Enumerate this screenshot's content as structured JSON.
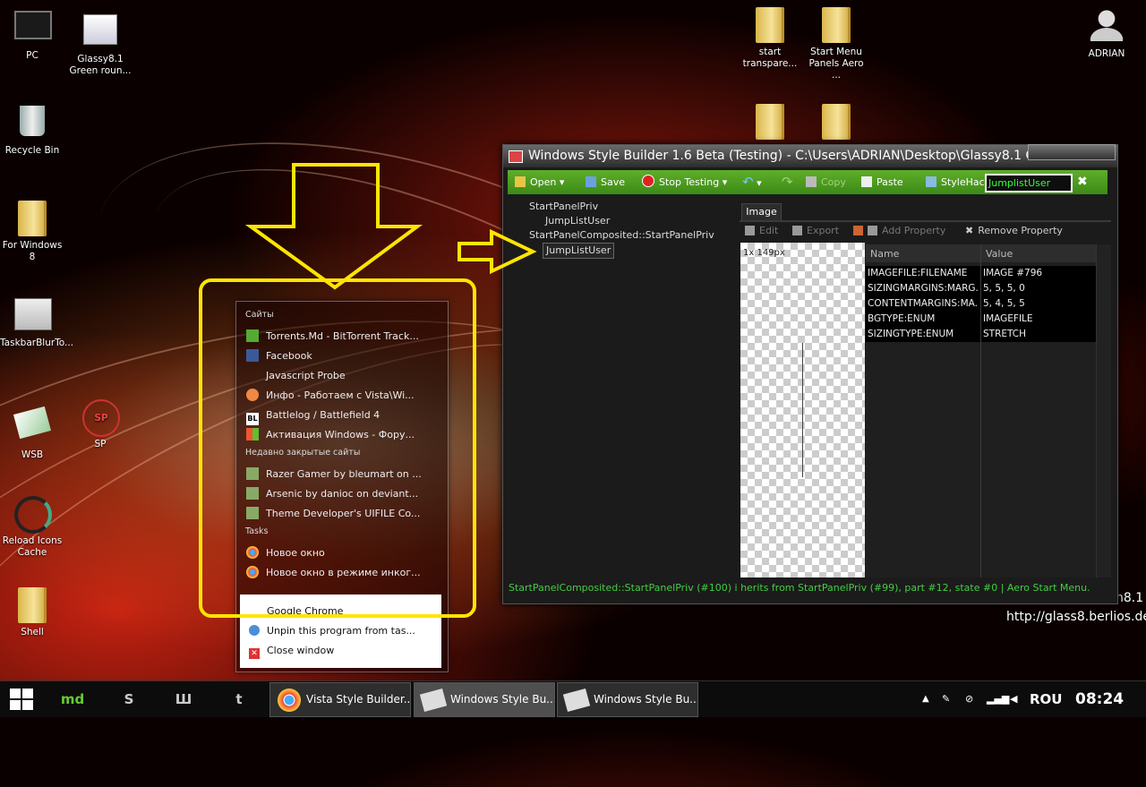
{
  "desktop": {
    "icons": [
      {
        "id": "pc",
        "label": "PC"
      },
      {
        "id": "glassy",
        "label": "Glassy8.1\nGreen roun..."
      },
      {
        "id": "recycle",
        "label": "Recycle Bin"
      },
      {
        "id": "forwin8",
        "label": "For Windows 8"
      },
      {
        "id": "taskbarblur",
        "label": "TaskbarBlurTo..."
      },
      {
        "id": "wsb",
        "label": "WSB"
      },
      {
        "id": "sp",
        "label": "SP"
      },
      {
        "id": "reload",
        "label": "Reload Icons\nCache"
      },
      {
        "id": "shell",
        "label": "Shell"
      },
      {
        "id": "starttransp",
        "label": "start\ntranspare..."
      },
      {
        "id": "startmenu",
        "label": "Start Menu\nPanels  Aero ..."
      },
      {
        "id": "adrian",
        "label": "ADRIAN"
      }
    ],
    "watermark_left": "n8.1",
    "watermark_url": "http://glass8.berlios.de"
  },
  "wsb": {
    "title": "Windows Style Builder 1.6 Beta (Testing) - C:\\Users\\ADRIAN\\Desktop\\Glassy8.1 Gr",
    "toolbar": {
      "open": "Open",
      "save": "Save",
      "stop": "Stop Testing",
      "copy": "Copy",
      "paste": "Paste",
      "stylehack": "StyleHack",
      "search_value": "JumplistUser"
    },
    "tree": [
      "StartPanelPriv",
      "JumpListUser",
      "StartPanelComposited::StartPanelPriv",
      "JumpListUser"
    ],
    "tab": "Image",
    "tools": {
      "edit": "Edit",
      "export": "Export",
      "add": "Add Property",
      "remove": "Remove Property"
    },
    "preview_label": "1x 149px",
    "props_header": {
      "name": "Name",
      "value": "Value"
    },
    "props": [
      {
        "name": "IMAGEFILE:FILENAME",
        "value": "IMAGE #796"
      },
      {
        "name": "SIZINGMARGINS:MARG...",
        "value": "5, 5, 5, 0"
      },
      {
        "name": "CONTENTMARGINS:MA...",
        "value": "5, 4, 5, 5"
      },
      {
        "name": "BGTYPE:ENUM",
        "value": "IMAGEFILE"
      },
      {
        "name": "SIZINGTYPE:ENUM",
        "value": "STRETCH"
      }
    ],
    "status": "StartPanelComposited::StartPanelPriv (#100) i  herits from StartPanelPriv (#99),  part #12,  state #0  |  Aero Start Menu."
  },
  "jumplist": {
    "cat_sites": "Сайты",
    "sites": [
      {
        "label": "Torrents.Md - BitTorrent Track...",
        "color": "#5a3"
      },
      {
        "label": "Facebook",
        "color": "#3b5998"
      },
      {
        "label": "Javascript Probe",
        "color": "transparent"
      },
      {
        "label": "Инфо - Работаем с Vista\\Wi...",
        "color": "#e84"
      },
      {
        "label": "Battlelog / Battlefield 4",
        "color": "#222"
      },
      {
        "label": "Активация Windows - Фору...",
        "color": "#4a8"
      }
    ],
    "cat_recent": "Недавно закрытые сайты",
    "recent": [
      {
        "label": "Razer Gamer by bleumart on ..."
      },
      {
        "label": "Arsenic by danioc on deviant..."
      },
      {
        "label": "Theme Developer's UIFILE Co..."
      }
    ],
    "cat_tasks": "Tasks",
    "tasks": [
      {
        "label": "Новое окно"
      },
      {
        "label": "Новое окно в режиме инког..."
      }
    ],
    "bottom": [
      {
        "label": "Google Chrome"
      },
      {
        "label": "Unpin this program from tas..."
      },
      {
        "label": "Close window"
      }
    ]
  },
  "taskbar": {
    "pins": [
      "md",
      "S",
      "Ш",
      "t"
    ],
    "tasks": [
      {
        "label": "Vista Style Builder..."
      },
      {
        "label": "Windows Style Bu..."
      },
      {
        "label": "Windows Style Bu..."
      }
    ],
    "lang": "ROU",
    "clock": "08:24"
  },
  "colors": {
    "toolbar": "#4a9a1f",
    "highlight": "#ffe500",
    "status": "#44cc44"
  }
}
